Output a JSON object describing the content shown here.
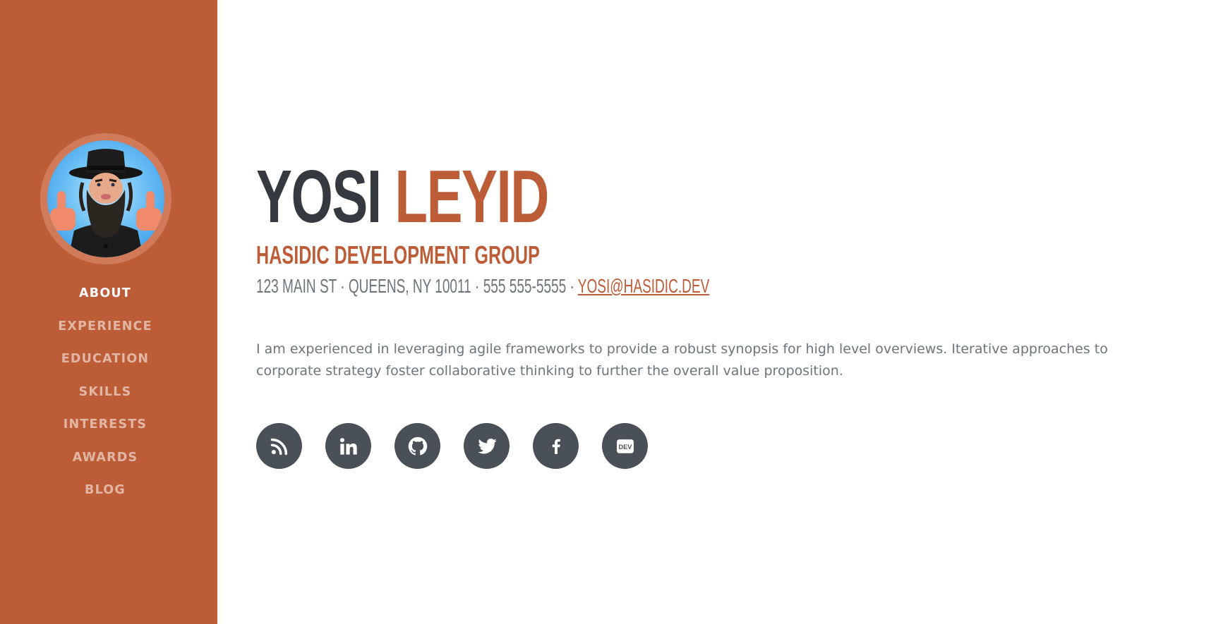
{
  "sidebar": {
    "avatar_icon": "profile-avatar-illustration",
    "nav": [
      {
        "label": "ABOUT",
        "active": true
      },
      {
        "label": "EXPERIENCE",
        "active": false
      },
      {
        "label": "EDUCATION",
        "active": false
      },
      {
        "label": "SKILLS",
        "active": false
      },
      {
        "label": "INTERESTS",
        "active": false
      },
      {
        "label": "AWARDS",
        "active": false
      },
      {
        "label": "BLOG",
        "active": false
      }
    ]
  },
  "main": {
    "first_name": "YOSI",
    "last_name": "LEYID",
    "company": "HASIDIC DEVELOPMENT GROUP",
    "address": "123 MAIN ST · QUEENS, NY 10011 · 555 555-5555 · ",
    "email": "YOSI@HASIDIC.DEV",
    "summary": "I am experienced in leveraging agile frameworks to provide a robust synopsis for high level overviews. Iterative approaches to corporate strategy foster collaborative thinking to further the overall value proposition.",
    "social_icons": [
      "rss-icon",
      "linkedin-icon",
      "github-icon",
      "twitter-icon",
      "facebook-icon",
      "dev-icon"
    ]
  },
  "colors": {
    "brand": "#bd5d38",
    "text_dark": "#343a40",
    "text_muted": "#6c757d",
    "social_bg": "#495057"
  }
}
